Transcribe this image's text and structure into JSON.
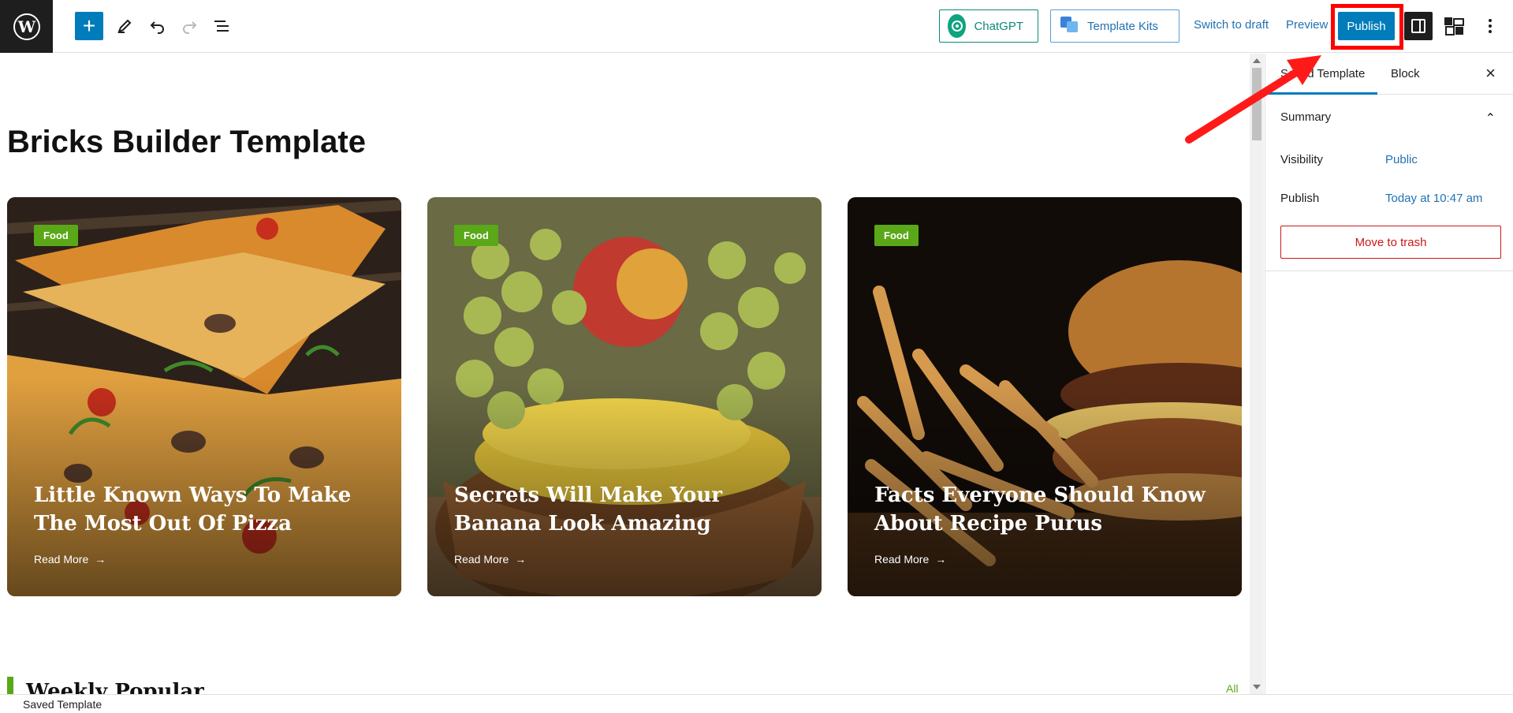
{
  "toolbar": {
    "chatgpt_label": "ChatGPT",
    "template_kits_label": "Template Kits",
    "switch_to_draft_label": "Switch to draft",
    "preview_label": "Preview",
    "publish_label": "Publish"
  },
  "page": {
    "title": "Bricks Builder Template"
  },
  "cards": [
    {
      "badge": "Food",
      "title": "Little Known Ways To Make The Most Out Of Pizza",
      "link": "Read More",
      "theme": "pizza"
    },
    {
      "badge": "Food",
      "title": "Secrets Will Make Your Banana Look Amazing",
      "link": "Read More",
      "theme": "fruit"
    },
    {
      "badge": "Food",
      "title": "Facts Everyone Should Know About Recipe Purus",
      "link": "Read More",
      "theme": "burger"
    }
  ],
  "section": {
    "heading": "Weekly Popular",
    "all_link": "All"
  },
  "sidebar": {
    "tab_template": "Saved Template",
    "tab_block": "Block",
    "summary_label": "Summary",
    "visibility_label": "Visibility",
    "visibility_value": "Public",
    "publish_label": "Publish",
    "publish_value": "Today at 10:47 am",
    "trash_label": "Move to trash"
  },
  "footer": {
    "breadcrumb": "Saved Template"
  },
  "colors": {
    "accent": "#007cba",
    "badge_green": "#5aa817",
    "highlight_red": "#ff0000"
  }
}
